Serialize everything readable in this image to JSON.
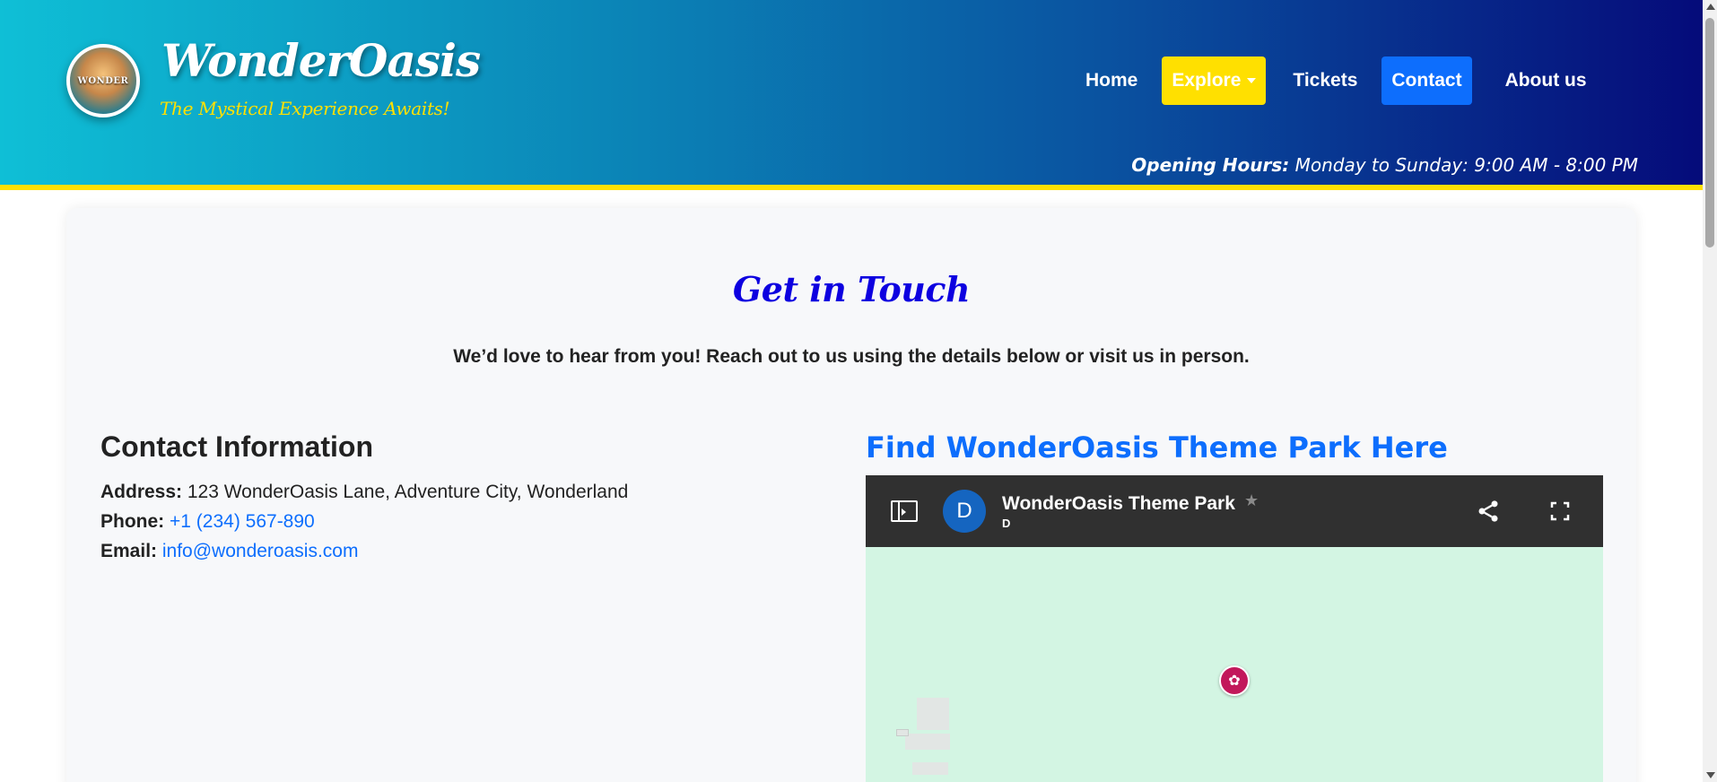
{
  "header": {
    "logo_text": "WONDER",
    "brand_title": "WonderOasis",
    "tagline": "The Mystical Experience Awaits!",
    "nav": [
      {
        "label": "Home"
      },
      {
        "label": "Explore"
      },
      {
        "label": "Tickets"
      },
      {
        "label": "Contact"
      },
      {
        "label": "About us"
      }
    ],
    "opening_label": "Opening Hours:",
    "opening_value": " Monday to Sunday: 9:00 AM - 8:00 PM"
  },
  "main": {
    "title": "Get in Touch",
    "intro": "We’d love to hear from you! Reach out to us using the details below or visit us in person.",
    "contact_heading": "Contact Information",
    "address_label": "Address:",
    "address_value": " 123 WonderOasis Lane, Adventure City, Wonderland",
    "phone_label": "Phone:",
    "phone_value": "+1 (234) 567-890",
    "email_label": "Email:",
    "email_value": "info@wonderoasis.com",
    "map_heading": "Find WonderOasis Theme Park Here"
  },
  "map": {
    "avatar_letter": "D",
    "title": "WonderOasis Theme Park",
    "subtitle": "D",
    "star": "★"
  },
  "colors": {
    "header_gradient_start": "#0fbfd6",
    "header_gradient_end": "#050b7a",
    "accent_yellow": "#ffe000",
    "primary_blue": "#0d6efd",
    "title_blue": "#0d00e0",
    "map_pin": "#c2185b"
  },
  "icons": {
    "map_sidebar": "sidebar-toggle-icon",
    "share": "share-icon",
    "fullscreen": "fullscreen-icon",
    "pin": "amusement-park-pin-icon",
    "star": "star-icon"
  }
}
